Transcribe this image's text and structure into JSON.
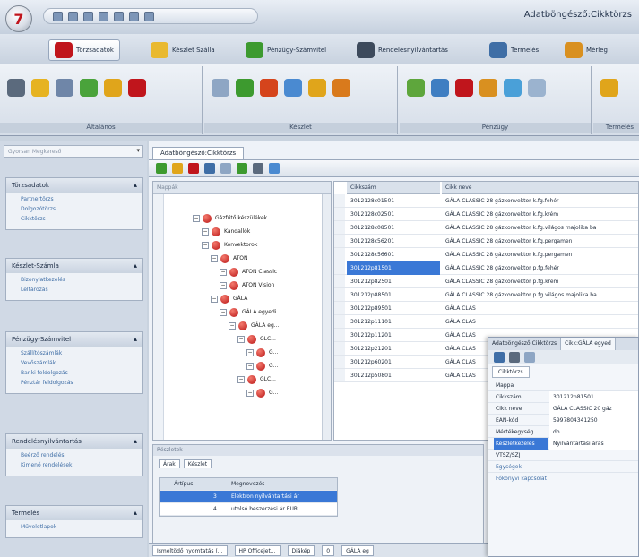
{
  "window": {
    "title": "Adatböngésző:Cikktörzs"
  },
  "ribbon": {
    "tabs": [
      {
        "label": "Törzsadatok",
        "icon": "briefcase-icon",
        "color": "#c0151c"
      },
      {
        "label": "Készlet Szálla",
        "icon": "folder-icon",
        "color": "#e9b92f"
      },
      {
        "label": "Pénzügy-Számvitel",
        "icon": "money-icon",
        "color": "#3d9a2f"
      },
      {
        "label": "Rendelésnyilvántartás",
        "icon": "cart-icon",
        "color": "#3d4a5c"
      },
      {
        "label": "Termelés",
        "icon": "gear-icon",
        "color": "#3f6ea6"
      },
      {
        "label": "Mérleg",
        "icon": "scale-icon",
        "color": "#d99020"
      }
    ],
    "groups": [
      {
        "label": "Általános"
      },
      {
        "label": "Készlet"
      },
      {
        "label": "Pénzügy"
      },
      {
        "label": "Termelés"
      }
    ]
  },
  "sidebar": {
    "search_placeholder": "Gyorsan Megkereső",
    "panels": [
      {
        "title": "Törzsadatok",
        "items": [
          "Partnertörzs",
          "Dolgozótörzs",
          "Cikktörzs"
        ]
      },
      {
        "title": "Készlet-Számla",
        "items": [
          "Bizonylatkezelés",
          "Leltározás"
        ]
      },
      {
        "title": "Pénzügy-Számvitel",
        "items": [
          "Szállítószámlák",
          "Vevőszámlák",
          "Banki feldolgozás",
          "Pénztár feldolgozás"
        ]
      },
      {
        "title": "Rendelésnyilvántartás",
        "items": [
          "Beérző rendelés",
          "Kimenő rendelések"
        ]
      },
      {
        "title": "Termelés",
        "items": [
          "Műveletlapok"
        ]
      }
    ]
  },
  "document": {
    "tab_label": "Adatböngésző:Cikktörzs",
    "tree_header": "Mappák",
    "tree": [
      {
        "label": "Gázfűtő készülékek",
        "level": 0
      },
      {
        "label": "Kandallók",
        "level": 1
      },
      {
        "label": "Konvektorok",
        "level": 1
      },
      {
        "label": "ATON",
        "level": 2
      },
      {
        "label": "ATON Classic",
        "level": 3
      },
      {
        "label": "ATON Vision",
        "level": 3
      },
      {
        "label": "GÁLA",
        "level": 2
      },
      {
        "label": "GÁLA egyedi",
        "level": 3
      },
      {
        "label": "GÁLA eg...",
        "level": 4
      },
      {
        "label": "GLC...",
        "level": 5
      },
      {
        "label": "G...",
        "level": 6
      },
      {
        "label": "G...",
        "level": 6
      },
      {
        "label": "GLC...",
        "level": 5
      },
      {
        "label": "G...",
        "level": 6
      }
    ],
    "grid": {
      "columns": [
        "Cikkszám",
        "Cikk neve"
      ],
      "rows": [
        {
          "code": "3012128c01501",
          "name": "GÁLA CLASSIC 28 gázkonvektor k.fg.fehér"
        },
        {
          "code": "3012128c02501",
          "name": "GÁLA CLASSIC 28 gázkonvektor k.fg.krém"
        },
        {
          "code": "3012128c08501",
          "name": "GÁLA CLASSIC 28 gázkonvektor k.fg.világos majolika ba"
        },
        {
          "code": "3012128c56201",
          "name": "GÁLA CLASSIC 28 gázkonvektor k.fg.pergamen"
        },
        {
          "code": "3012128c56601",
          "name": "GÁLA CLASSIC 28 gázkonvektor k.fg.pergamen"
        },
        {
          "code": "301212p81501",
          "name": "GÁLA CLASSIC 28 gázkonvektor p.fg.fehér"
        },
        {
          "code": "301212p82501",
          "name": "GÁLA CLASSIC 28 gázkonvektor p.fg.krém"
        },
        {
          "code": "301212p88501",
          "name": "GÁLA CLASSIC 28 gázkonvektor p.fg.világos majolika ba"
        },
        {
          "code": "301212p89501",
          "name": "GÁLA CLAS"
        },
        {
          "code": "301212p11101",
          "name": "GÁLA CLAS"
        },
        {
          "code": "301212p11201",
          "name": "GÁLA CLAS"
        },
        {
          "code": "301212p21201",
          "name": "GÁLA CLAS"
        },
        {
          "code": "301212p60201",
          "name": "GÁLA CLAS"
        },
        {
          "code": "301212p50801",
          "name": "GÁLA CLAS"
        }
      ],
      "selected_row": 5
    },
    "bottom": {
      "header": "Részletek",
      "tabs": [
        "Árak",
        "Készlet"
      ],
      "columns": [
        "Ártípus",
        "Megnevezés"
      ],
      "rows": [
        {
          "num": "3",
          "name": "Elektron nyilvántartási ár"
        },
        {
          "num": "4",
          "name": "utolsó beszerzési ár EUR"
        }
      ]
    },
    "statusbar": {
      "items": [
        "Ismeltödő nyomtatás (...",
        "HP Officejet...",
        "Diákép",
        "0",
        "GÁLA eg"
      ]
    }
  },
  "detail_window": {
    "tabs": [
      "Adatböngésző:Cikktörzs",
      "Cikk:GÁLA egyed"
    ],
    "sub_tab": "Cikktörzs",
    "fields": [
      {
        "label": "Mappa",
        "value": ""
      },
      {
        "label": "Cikkszám",
        "value": "301212p81501"
      },
      {
        "label": "Cikk neve",
        "value": "GÁLA CLASSIC 20 gáz"
      },
      {
        "label": "EAN-kód",
        "value": "5997804341250"
      },
      {
        "label": "Mértékegység",
        "value": "db"
      },
      {
        "label": "Készletkezelés",
        "value": "Nyilvántartási áras"
      },
      {
        "label": "VTSZ/SZJ",
        "value": ""
      },
      {
        "label": "Egységek",
        "value": ""
      },
      {
        "label": "Főkönyvi kapcsolat",
        "value": ""
      }
    ],
    "highlighted_field": 5
  }
}
